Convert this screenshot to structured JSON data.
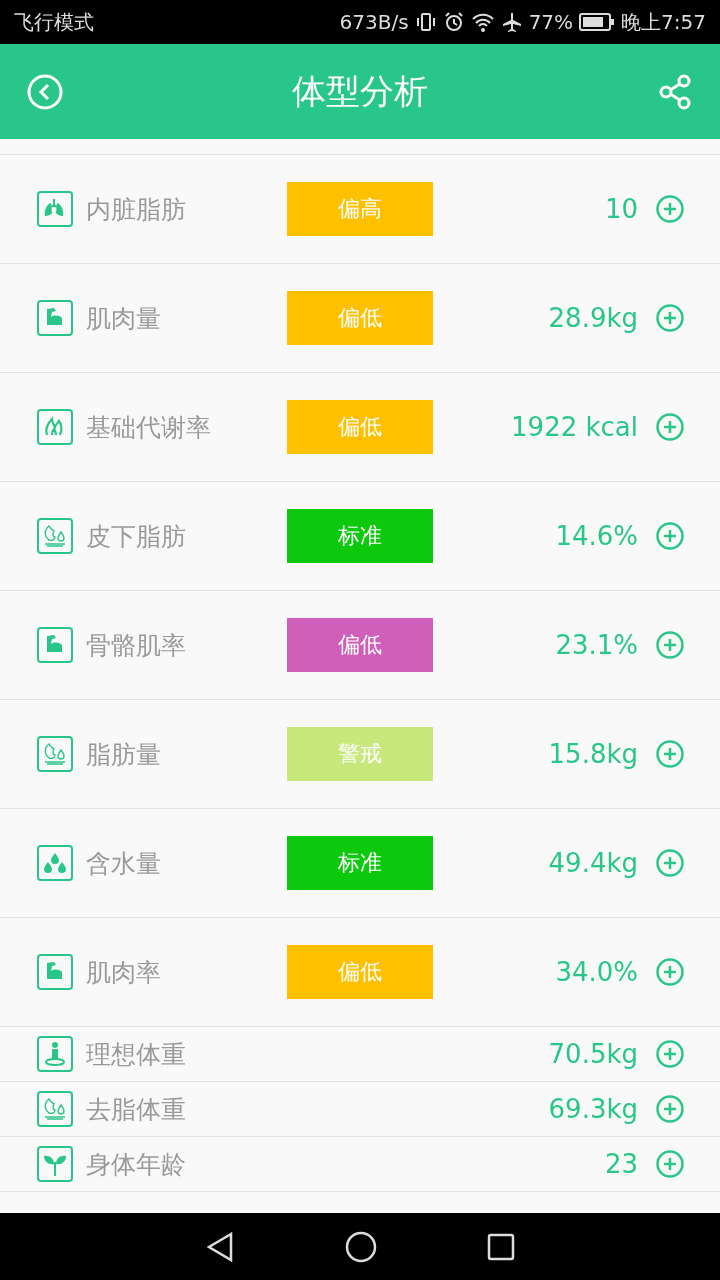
{
  "status_bar": {
    "mode": "飞行模式",
    "speed": "673B/s",
    "battery": "77%",
    "time": "晚上7:57"
  },
  "header": {
    "title": "体型分析"
  },
  "rows": [
    {
      "kind": "lungs",
      "label": "内脏脂肪",
      "badge": "偏高",
      "color": "#ffc000",
      "value": "10"
    },
    {
      "kind": "muscle",
      "label": "肌肉量",
      "badge": "偏低",
      "color": "#ffc000",
      "value": "28.9kg"
    },
    {
      "kind": "flame",
      "label": "基础代谢率",
      "badge": "偏低",
      "color": "#ffc000",
      "value": "1922 kcal"
    },
    {
      "kind": "fat",
      "label": "皮下脂肪",
      "badge": "标准",
      "color": "#0dc90d",
      "value": "14.6%"
    },
    {
      "kind": "muscle",
      "label": "骨骼肌率",
      "badge": "偏低",
      "color": "#cf5fbb",
      "value": "23.1%"
    },
    {
      "kind": "fat",
      "label": "脂肪量",
      "badge": "警戒",
      "color": "#c8e87c",
      "value": "15.8kg"
    },
    {
      "kind": "drops",
      "label": "含水量",
      "badge": "标准",
      "color": "#0dc90d",
      "value": "49.4kg"
    },
    {
      "kind": "muscle",
      "label": "肌肉率",
      "badge": "偏低",
      "color": "#ffc000",
      "value": "34.0%"
    },
    {
      "kind": "person",
      "label": "理想体重",
      "value": "70.5kg"
    },
    {
      "kind": "fat",
      "label": "去脂体重",
      "value": "69.3kg"
    },
    {
      "kind": "sprout",
      "label": "身体年龄",
      "value": "23"
    }
  ]
}
